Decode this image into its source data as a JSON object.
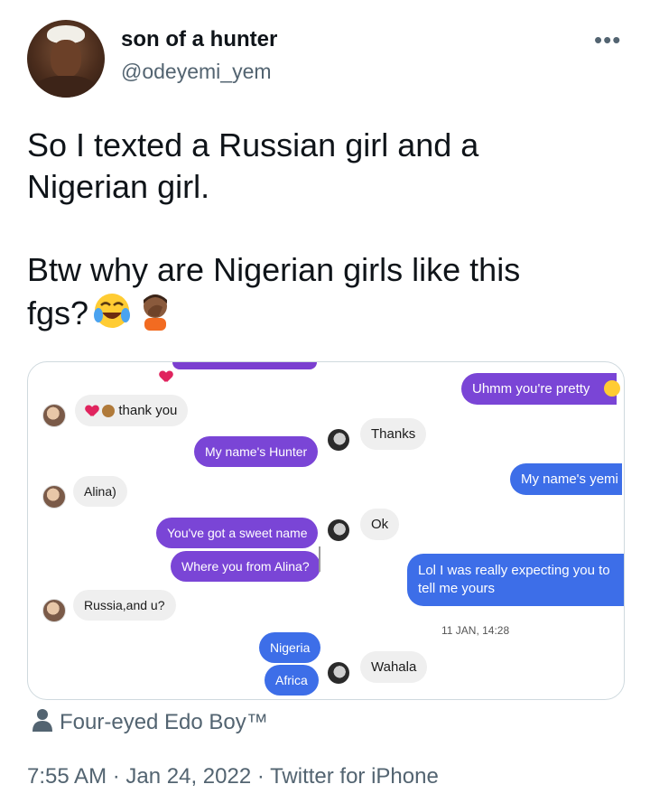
{
  "user": {
    "display_name": "son of a hunter",
    "handle": "@odeyemi_yem"
  },
  "more_icon": "more-horizontal-icon",
  "tweet": {
    "text_line1": "So I texted a Russian girl and a\nNigerian girl.",
    "text_line2": "Btw why are Nigerian girls like this\nfgs?"
  },
  "left_chat": {
    "msg1": "thank you",
    "msg2": "My name's Hunter",
    "msg3": "Alina)",
    "msg4": "You've got a sweet name",
    "msg5": "Where you from Alina?",
    "msg6": "Russia,and u?",
    "msg7": "Nigeria",
    "msg8": "Africa"
  },
  "right_chat": {
    "msg1": "Uhmm you're pretty",
    "msg2": "Thanks",
    "msg3": "My name's yemi",
    "msg4": "Ok",
    "msg5": "Lol I was really expecting you to\ntell me yours",
    "timestamp": "11 JAN, 14:28",
    "msg6": "Wahala"
  },
  "attribution": "Four-eyed Edo Boy™",
  "meta": "7:55 AM · Jan 24, 2022 · Twitter for iPhone",
  "colors": {
    "purple_bubble": "#7a45d6",
    "blue_bubble": "#3d6ee8",
    "gray_bubble": "#efefef",
    "secondary_text": "#536471"
  }
}
